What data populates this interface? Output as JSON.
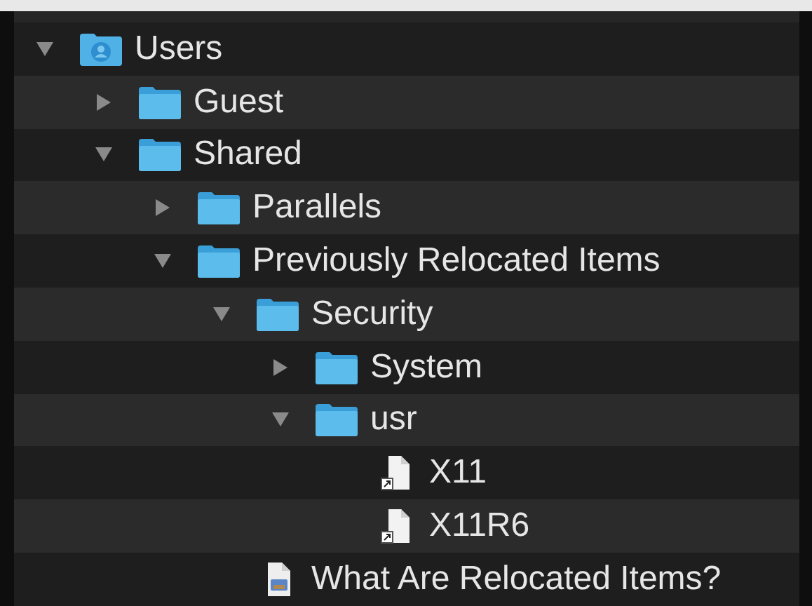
{
  "tree": [
    {
      "name": "Users",
      "kind": "user-folder",
      "expanded": true,
      "children": [
        {
          "name": "Guest",
          "kind": "folder",
          "expanded": false
        },
        {
          "name": "Shared",
          "kind": "folder",
          "expanded": true,
          "children": [
            {
              "name": "Parallels",
              "kind": "folder",
              "expanded": false
            },
            {
              "name": "Previously Relocated Items",
              "kind": "folder",
              "expanded": true,
              "children": [
                {
                  "name": "Security",
                  "kind": "folder",
                  "expanded": true,
                  "children": [
                    {
                      "name": "System",
                      "kind": "folder",
                      "expanded": false
                    },
                    {
                      "name": "usr",
                      "kind": "folder",
                      "expanded": true,
                      "children": [
                        {
                          "name": "X11",
                          "kind": "alias"
                        },
                        {
                          "name": "X11R6",
                          "kind": "alias"
                        }
                      ]
                    }
                  ]
                },
                {
                  "name": "What Are Relocated Items?",
                  "kind": "document"
                }
              ]
            }
          ]
        }
      ]
    }
  ]
}
